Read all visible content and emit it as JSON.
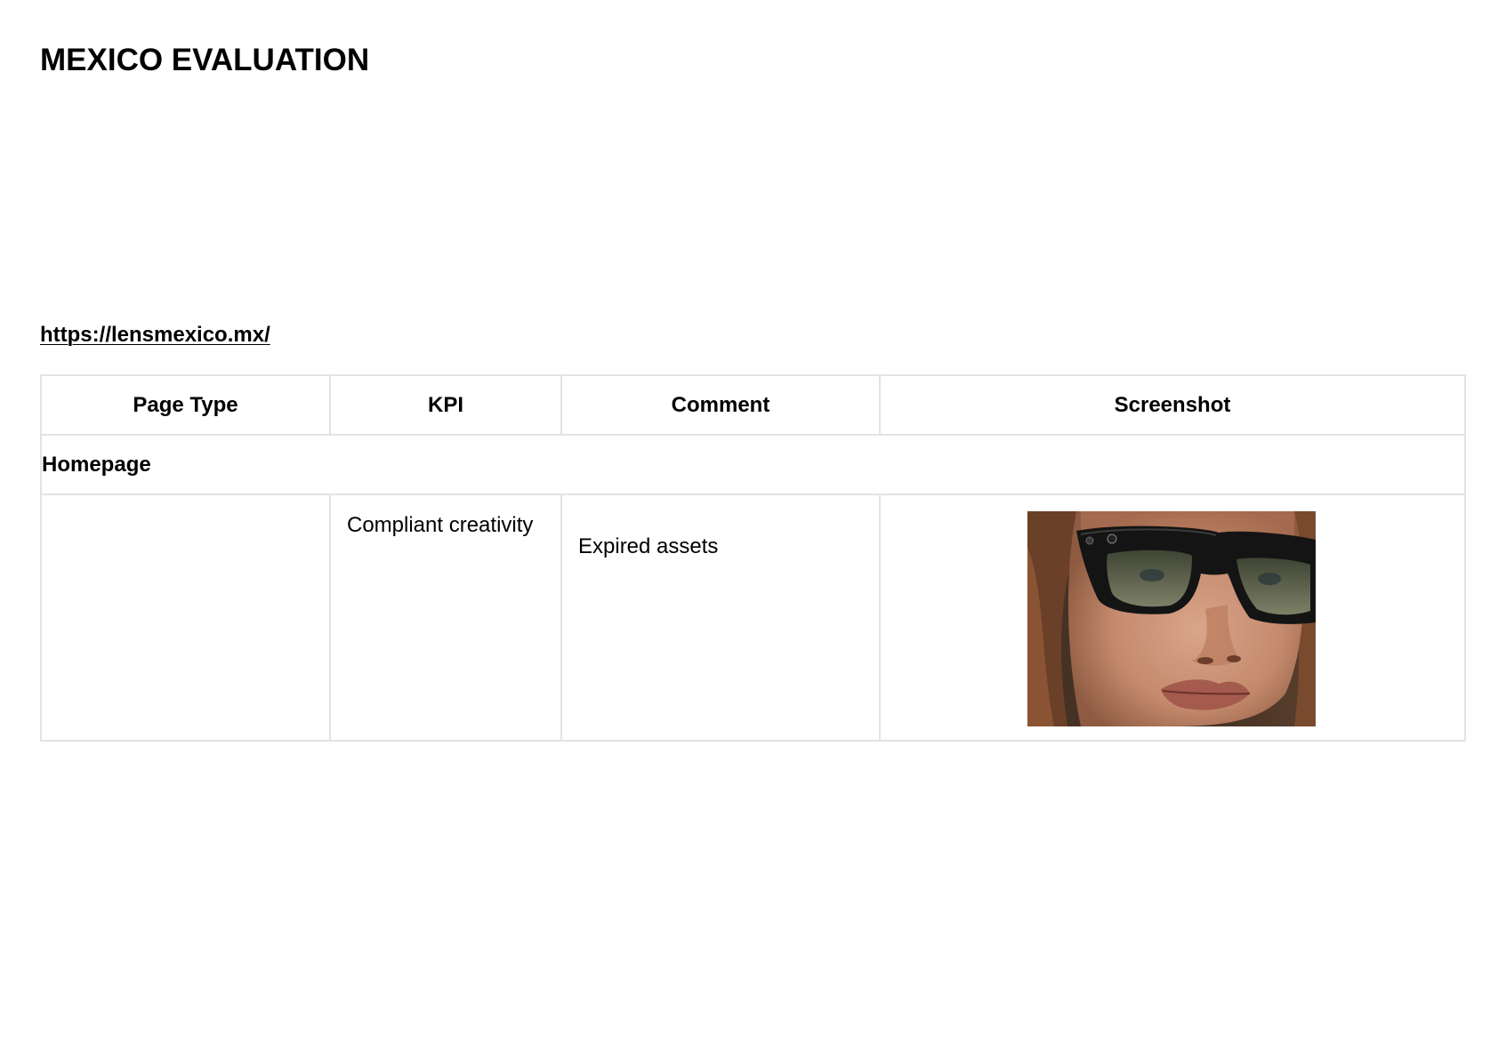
{
  "document": {
    "title": "MEXICO EVALUATION",
    "url": "https://lensmexico.mx/"
  },
  "table": {
    "headers": {
      "page_type": "Page Type",
      "kpi": "KPI",
      "comment": "Comment",
      "screenshot": "Screenshot"
    },
    "section": "Homepage",
    "rows": [
      {
        "page_type": "",
        "kpi": "Compliant creativity",
        "comment": "Expired assets",
        "screenshot_icon": "portrait-sunglasses-image"
      }
    ]
  },
  "colors": {
    "border": "#e3e3e3",
    "text": "#000000",
    "background": "#ffffff"
  }
}
